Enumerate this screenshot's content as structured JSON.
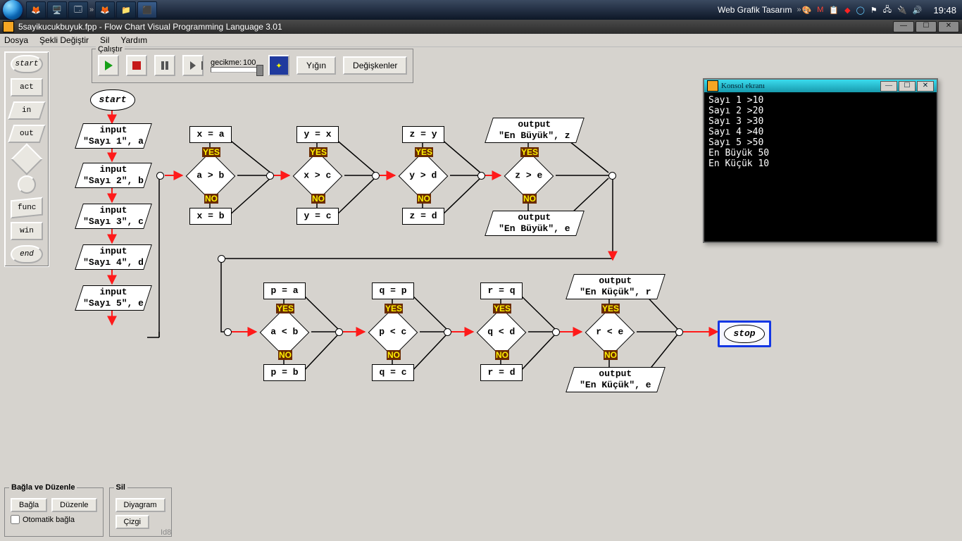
{
  "taskbar": {
    "web_text": "Web Grafik Tasarım",
    "clock": "19:48"
  },
  "app": {
    "title": "5sayikucukbuyuk.fpp - Flow Chart Visual Programming Language 3.01",
    "menu": [
      "Dosya",
      "Şekli Değiştir",
      "Sil",
      "Yardım"
    ],
    "run": {
      "legend": "Çalıştır",
      "delay_label": "gecikme:",
      "delay_value": "100",
      "stack_btn": "Yığın",
      "vars_btn": "Değişkenler"
    },
    "palette": {
      "start": "start",
      "act": "act",
      "in": "in",
      "out": "out",
      "diamond": "◇",
      "circle": "○",
      "func": "func",
      "win": "win",
      "end": "end"
    },
    "nodes": {
      "start": "start",
      "inputs": [
        "input\n\"Sayı 1\", a",
        "input\n\"Sayı 2\", b",
        "input\n\"Sayı 3\", c",
        "input\n\"Sayı 4\", d",
        "input\n\"Sayı 5\", e"
      ],
      "big": {
        "cond": [
          "a > b",
          "x > c",
          "y > d",
          "z > e"
        ],
        "yes_act": [
          "x = a",
          "y = x",
          "z = y"
        ],
        "no_act": [
          "x = b",
          "y = c",
          "z = d"
        ],
        "yes_out": "output\n\"En Büyük\", z",
        "no_out": "output\n\"En Büyük\", e"
      },
      "small": {
        "cond": [
          "a < b",
          "p < c",
          "q < d",
          "r < e"
        ],
        "yes_act": [
          "p = a",
          "q = p",
          "r = q"
        ],
        "no_act": [
          "p = b",
          "q = c",
          "r = d"
        ],
        "yes_out": "output\n\"En Küçük\", r",
        "no_out": "output\n\"En Küçük\", e"
      },
      "stop": "stop",
      "tag_yes": "YES",
      "tag_no": "NO"
    },
    "console": {
      "title": "Konsol ekranı",
      "lines": [
        "Sayı 1 >10",
        "Sayı 2 >20",
        "Sayı 3 >30",
        "Sayı 4 >40",
        "Sayı 5 >50",
        "En Büyük 50",
        "En Küçük 10"
      ]
    },
    "bottom": {
      "b1": {
        "legend": "Bağla ve Düzenle",
        "bagla": "Bağla",
        "duzenle": "Düzenle",
        "auto": "Otomatik bağla"
      },
      "b2": {
        "legend": "Sil",
        "diagram": "Diyagram",
        "cizgi": "Çizgi"
      },
      "status": "Id8"
    }
  }
}
